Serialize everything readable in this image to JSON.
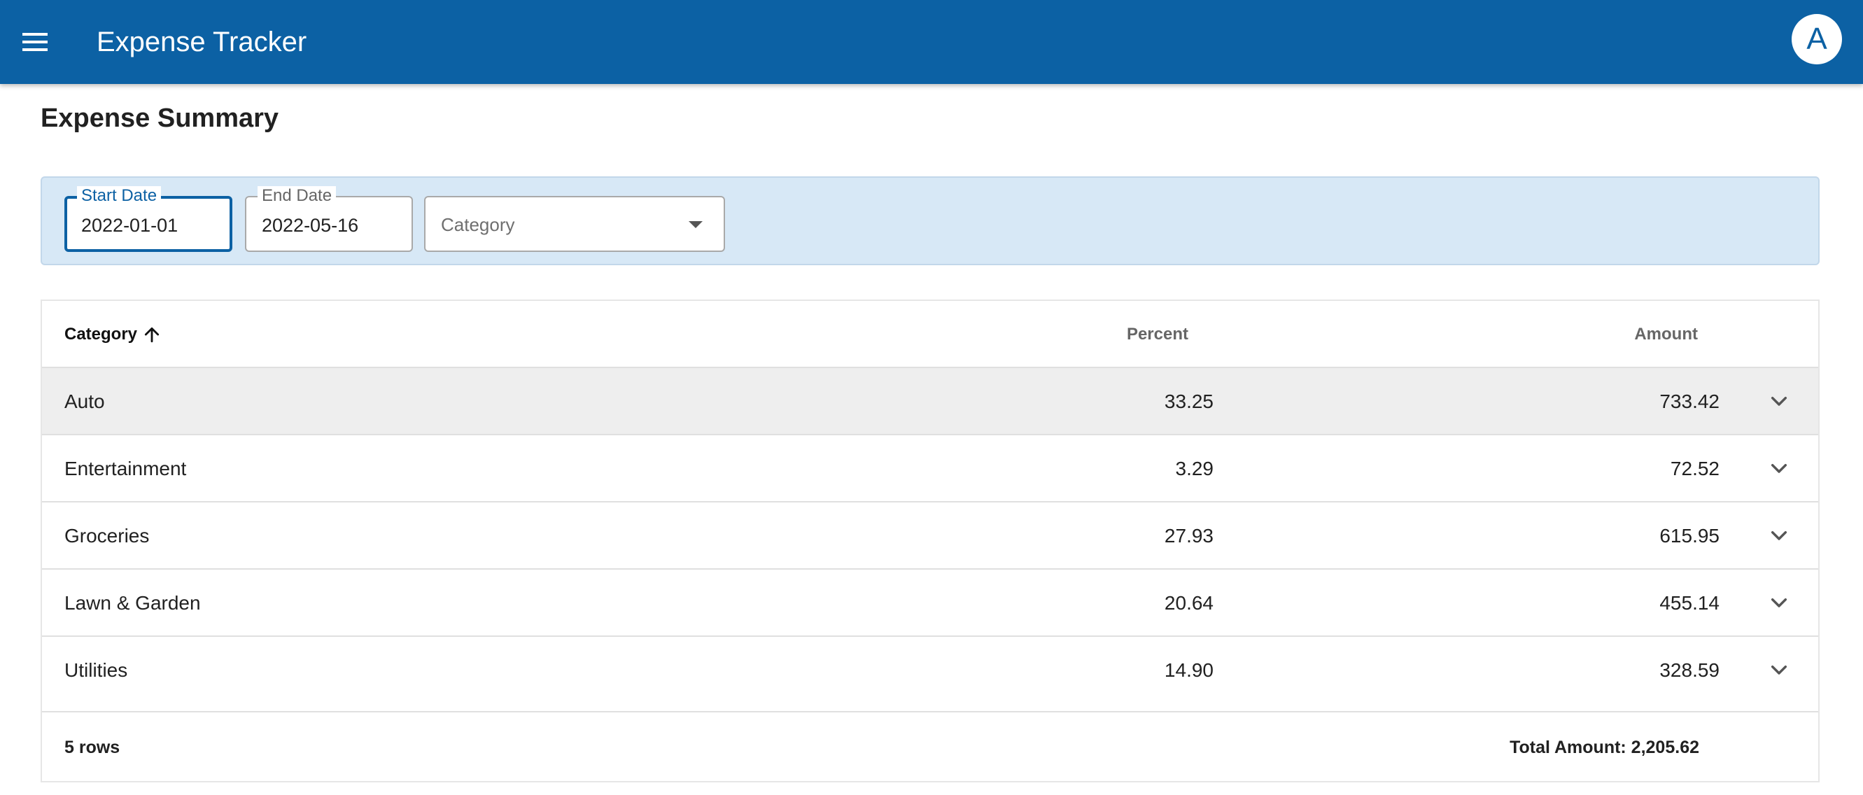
{
  "app": {
    "title": "Expense Tracker",
    "avatar_initial": "A",
    "brand_color": "#0c61a4"
  },
  "page": {
    "title": "Expense Summary"
  },
  "filters": {
    "start_date": {
      "label": "Start Date",
      "value": "2022-01-01"
    },
    "end_date": {
      "label": "End Date",
      "value": "2022-05-16"
    },
    "category": {
      "placeholder": "Category"
    }
  },
  "table": {
    "columns": {
      "category": "Category",
      "percent": "Percent",
      "amount": "Amount"
    },
    "sort": {
      "column": "category",
      "direction": "ascending"
    },
    "rows": [
      {
        "category": "Auto",
        "percent": "33.25",
        "amount": "733.42"
      },
      {
        "category": "Entertainment",
        "percent": "3.29",
        "amount": "72.52"
      },
      {
        "category": "Groceries",
        "percent": "27.93",
        "amount": "615.95"
      },
      {
        "category": "Lawn & Garden",
        "percent": "20.64",
        "amount": "455.14"
      },
      {
        "category": "Utilities",
        "percent": "14.90",
        "amount": "328.59"
      }
    ],
    "footer": {
      "row_count": "5 rows",
      "total": "Total Amount: 2,205.62"
    }
  },
  "icons": {
    "menu": "menu-icon",
    "sort": "arrow-up-icon",
    "expand": "chevron-down-icon",
    "dropdown": "caret-down-icon"
  }
}
